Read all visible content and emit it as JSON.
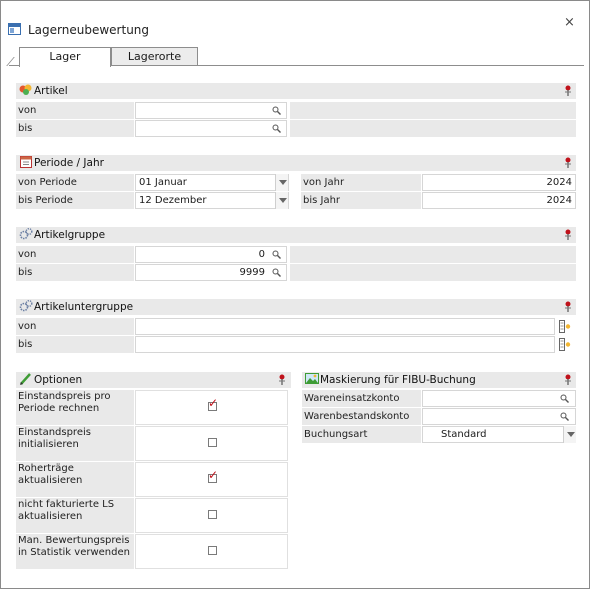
{
  "window": {
    "title": "Lagerneubewertung",
    "close_glyph": "×"
  },
  "tabs": [
    {
      "label": "Lager"
    },
    {
      "label": "Lagerorte"
    }
  ],
  "artikel": {
    "title": "Artikel",
    "rows": [
      {
        "label": "von",
        "value": ""
      },
      {
        "label": "bis",
        "value": ""
      }
    ]
  },
  "periode": {
    "title": "Periode / Jahr",
    "von_periode_label": "von Periode",
    "von_periode_value": "01 Januar",
    "bis_periode_label": "bis Periode",
    "bis_periode_value": "12 Dezember",
    "von_jahr_label": "von Jahr",
    "von_jahr_value": "2024",
    "bis_jahr_label": "bis Jahr",
    "bis_jahr_value": "2024"
  },
  "artikelgruppe": {
    "title": "Artikelgruppe",
    "rows": [
      {
        "label": "von",
        "value": "0"
      },
      {
        "label": "bis",
        "value": "9999"
      }
    ]
  },
  "artikeluntergruppe": {
    "title": "Artikeluntergruppe",
    "rows": [
      {
        "label": "von",
        "value": ""
      },
      {
        "label": "bis",
        "value": ""
      }
    ]
  },
  "optionen": {
    "title": "Optionen",
    "items": [
      {
        "line1": "Einstandspreis pro",
        "line2": "Periode rechnen",
        "checked": true
      },
      {
        "line1": "Einstandspreis",
        "line2": "initialisieren",
        "checked": false
      },
      {
        "line1": "Roherträge",
        "line2": "aktualisieren",
        "checked": true
      },
      {
        "line1": "nicht fakturierte LS",
        "line2": "aktualisieren",
        "checked": false
      },
      {
        "line1": "Man. Bewertungspreis",
        "line2": "in Statistik verwenden",
        "checked": false
      }
    ]
  },
  "fibu": {
    "title": "Maskierung für FIBU-Buchung",
    "wareneinsatz_label": "Wareneinsatzkonto",
    "wareneinsatz_value": "",
    "warenbestand_label": "Warenbestandskonto",
    "warenbestand_value": "",
    "buchungsart_label": "Buchungsart",
    "buchungsart_value": "Standard"
  },
  "icons": {
    "artikel": "articles-icon",
    "periode": "calendar-icon",
    "gruppe": "gear-group-icon",
    "optionen": "pencil-icon",
    "fibu": "image-icon",
    "pin": "pin-icon",
    "search": "magnifier-icon",
    "lookup": "lookup-icon"
  },
  "colors": {
    "check": "#c0121b",
    "section_bg": "#e9e9e9",
    "accent": "#3a6fb0"
  }
}
